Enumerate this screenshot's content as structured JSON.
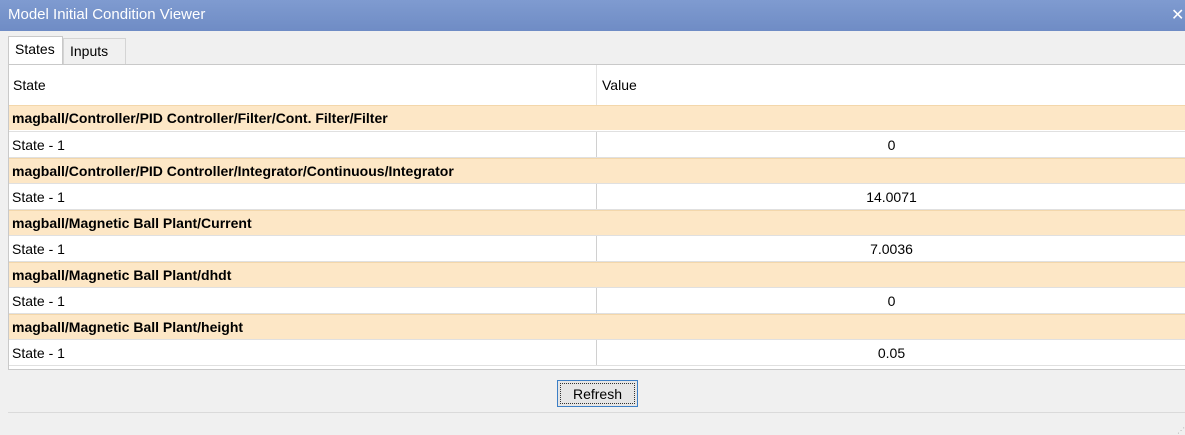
{
  "window": {
    "title": "Model Initial Condition Viewer",
    "close_glyph": "✕"
  },
  "tabs": [
    {
      "label": "States",
      "active": true
    },
    {
      "label": "Inputs",
      "active": false
    }
  ],
  "table": {
    "columns": [
      "State",
      "Value"
    ],
    "groups": [
      {
        "name": "magball/Controller/PID Controller/Filter/Cont. Filter/Filter",
        "state": "State - 1",
        "value": "0"
      },
      {
        "name": "magball/Controller/PID Controller/Integrator/Continuous/Integrator",
        "state": "State - 1",
        "value": "14.0071"
      },
      {
        "name": "magball/Magnetic Ball Plant/Current",
        "state": "State - 1",
        "value": "7.0036"
      },
      {
        "name": "magball/Magnetic Ball Plant/dhdt",
        "state": "State - 1",
        "value": "0"
      },
      {
        "name": "magball/Magnetic Ball Plant/height",
        "state": "State - 1",
        "value": "0.05"
      }
    ]
  },
  "actions": {
    "refresh_label": "Refresh"
  },
  "colors": {
    "titlebar": "#7f9bd0",
    "group_row": "#fde7c6",
    "button_border": "#3c7fc6"
  }
}
